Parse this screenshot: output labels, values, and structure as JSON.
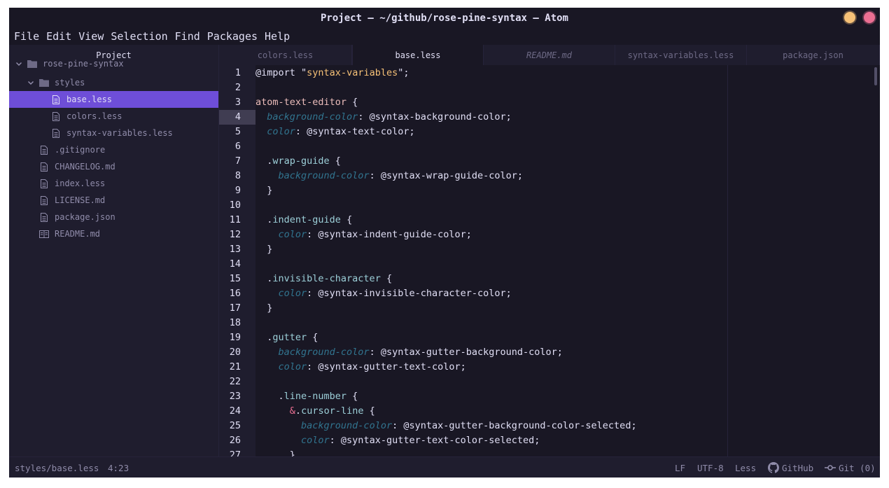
{
  "window": {
    "title": "Project — ~/github/rose-pine-syntax — Atom"
  },
  "menu": [
    "File",
    "Edit",
    "View",
    "Selection",
    "Find",
    "Packages",
    "Help"
  ],
  "sidebar": {
    "header": "Project",
    "items": [
      {
        "label": "rose-pine-syntax",
        "type": "folder",
        "expanded": true,
        "depth": 0,
        "selected": false
      },
      {
        "label": "styles",
        "type": "folder",
        "expanded": true,
        "depth": 1,
        "selected": false
      },
      {
        "label": "base.less",
        "type": "file",
        "depth": 2,
        "selected": true
      },
      {
        "label": "colors.less",
        "type": "file",
        "depth": 2,
        "selected": false
      },
      {
        "label": "syntax-variables.less",
        "type": "file",
        "depth": 2,
        "selected": false
      },
      {
        "label": ".gitignore",
        "type": "file",
        "depth": 1,
        "selected": false
      },
      {
        "label": "CHANGELOG.md",
        "type": "file",
        "depth": 1,
        "selected": false
      },
      {
        "label": "index.less",
        "type": "file",
        "depth": 1,
        "selected": false
      },
      {
        "label": "LICENSE.md",
        "type": "file",
        "depth": 1,
        "selected": false
      },
      {
        "label": "package.json",
        "type": "file",
        "depth": 1,
        "selected": false
      },
      {
        "label": "README.md",
        "type": "book",
        "depth": 1,
        "selected": false
      }
    ]
  },
  "tabs": [
    {
      "label": "colors.less",
      "active": false,
      "italic": false
    },
    {
      "label": "base.less",
      "active": true,
      "italic": false
    },
    {
      "label": "README.md",
      "active": false,
      "italic": true
    },
    {
      "label": "syntax-variables.less",
      "active": false,
      "italic": false
    },
    {
      "label": "package.json",
      "active": false,
      "italic": false
    }
  ],
  "editor": {
    "cursor_line": 4,
    "lines": [
      [
        [
          "@import ",
          "plain"
        ],
        [
          "\"",
          "punct"
        ],
        [
          "syntax-variables",
          "string"
        ],
        [
          "\"",
          "punct"
        ],
        [
          ";",
          "plain"
        ]
      ],
      [],
      [
        [
          "atom-text-editor",
          "tag"
        ],
        [
          " {",
          "plain"
        ]
      ],
      [
        [
          "  ",
          "plain"
        ],
        [
          "background-color",
          "prop"
        ],
        [
          ": @syntax-background-color;",
          "plain"
        ]
      ],
      [
        [
          "  ",
          "plain"
        ],
        [
          "color",
          "prop"
        ],
        [
          ": @syntax-text-color;",
          "plain"
        ]
      ],
      [],
      [
        [
          "  .",
          "plain"
        ],
        [
          "wrap-guide",
          "cls"
        ],
        [
          " {",
          "plain"
        ]
      ],
      [
        [
          "    ",
          "plain"
        ],
        [
          "background-color",
          "prop"
        ],
        [
          ": @syntax-wrap-guide-color;",
          "plain"
        ]
      ],
      [
        [
          "  }",
          "plain"
        ]
      ],
      [],
      [
        [
          "  .",
          "plain"
        ],
        [
          "indent-guide",
          "cls"
        ],
        [
          " {",
          "plain"
        ]
      ],
      [
        [
          "    ",
          "plain"
        ],
        [
          "color",
          "prop"
        ],
        [
          ": @syntax-indent-guide-color;",
          "plain"
        ]
      ],
      [
        [
          "  }",
          "plain"
        ]
      ],
      [],
      [
        [
          "  .",
          "plain"
        ],
        [
          "invisible-character",
          "cls"
        ],
        [
          " {",
          "plain"
        ]
      ],
      [
        [
          "    ",
          "plain"
        ],
        [
          "color",
          "prop"
        ],
        [
          ": @syntax-invisible-character-color;",
          "plain"
        ]
      ],
      [
        [
          "  }",
          "plain"
        ]
      ],
      [],
      [
        [
          "  .",
          "plain"
        ],
        [
          "gutter",
          "cls"
        ],
        [
          " {",
          "plain"
        ]
      ],
      [
        [
          "    ",
          "plain"
        ],
        [
          "background-color",
          "prop"
        ],
        [
          ": @syntax-gutter-background-color;",
          "plain"
        ]
      ],
      [
        [
          "    ",
          "plain"
        ],
        [
          "color",
          "prop"
        ],
        [
          ": @syntax-gutter-text-color;",
          "plain"
        ]
      ],
      [],
      [
        [
          "    .",
          "plain"
        ],
        [
          "line-number",
          "cls"
        ],
        [
          " {",
          "plain"
        ]
      ],
      [
        [
          "      ",
          "plain"
        ],
        [
          "&",
          "amp"
        ],
        [
          ".",
          "plain"
        ],
        [
          "cursor-line",
          "cls"
        ],
        [
          " {",
          "plain"
        ]
      ],
      [
        [
          "        ",
          "plain"
        ],
        [
          "background-color",
          "prop"
        ],
        [
          ": @syntax-gutter-background-color-selected;",
          "plain"
        ]
      ],
      [
        [
          "        ",
          "plain"
        ],
        [
          "color",
          "prop"
        ],
        [
          ": @syntax-gutter-text-color-selected;",
          "plain"
        ]
      ],
      [
        [
          "      }",
          "plain"
        ]
      ]
    ]
  },
  "status": {
    "file": "styles/base.less",
    "position": "4:23",
    "line_ending": "LF",
    "encoding": "UTF-8",
    "grammar": "Less",
    "github": "GitHub",
    "git": "Git (0)"
  },
  "colors": {
    "bg": "#191724",
    "surface": "#1f1d2e",
    "text": "#e0def4",
    "subtle": "#908caa",
    "muted": "#6e6a86",
    "selection": "#6e4ed8",
    "gold": "#f6c177",
    "love": "#eb6f92",
    "foam": "#9ccfd8",
    "pine": "#31748f",
    "rose": "#ebbcba"
  }
}
